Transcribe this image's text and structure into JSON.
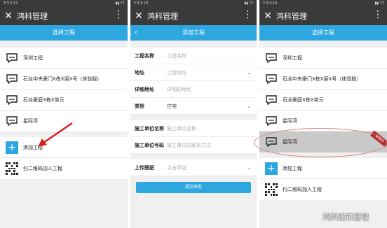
{
  "app": {
    "title": "鸿科管理"
  },
  "panel1": {
    "time": "下午3:17",
    "header": "选择工程",
    "projects": [
      "深圳工程",
      "石龙中央豪门X栋X层X号（体验版）",
      "石龙豪庭X栋X单元",
      "星际湾"
    ],
    "actions": {
      "add": "添加工程",
      "scan": "扫二维码加入工程"
    }
  },
  "panel2": {
    "time": "下午3:18",
    "header": "添加工程",
    "fields": {
      "name": {
        "label": "工程名称",
        "placeholder": "工程名称"
      },
      "address": {
        "label": "地址",
        "placeholder": "工程地址"
      },
      "detail": {
        "label": "详细地址",
        "placeholder": "详细的地址"
      },
      "type": {
        "label": "类型",
        "value": "住宅"
      },
      "unit_name": {
        "label": "施工单位名称",
        "placeholder": "施工单位名称"
      },
      "unit_phone": {
        "label": "施工单位号码",
        "placeholder": "施工单位的联系方式"
      },
      "upload": {
        "label": "上传图纸",
        "placeholder": "点击添加"
      }
    },
    "submit": "提交审批"
  },
  "panel3": {
    "time": "下午3:19",
    "header": "选择工程",
    "projects": [
      "深圳工程",
      "石龙中央豪门X栋X层X号（体验版）",
      "石龙豪庭X栋X单元",
      "星际湾",
      "星际湾"
    ],
    "badge": "审核中",
    "actions": {
      "add": "添加工程",
      "scan": "扫二维码加入工程"
    }
  },
  "watermark": "鸿科建筑管理",
  "colors": {
    "accent": "#2ea7e0",
    "titlebar": "#3a3a3a",
    "badge": "#b52a2a",
    "arrow": "#d62020"
  }
}
